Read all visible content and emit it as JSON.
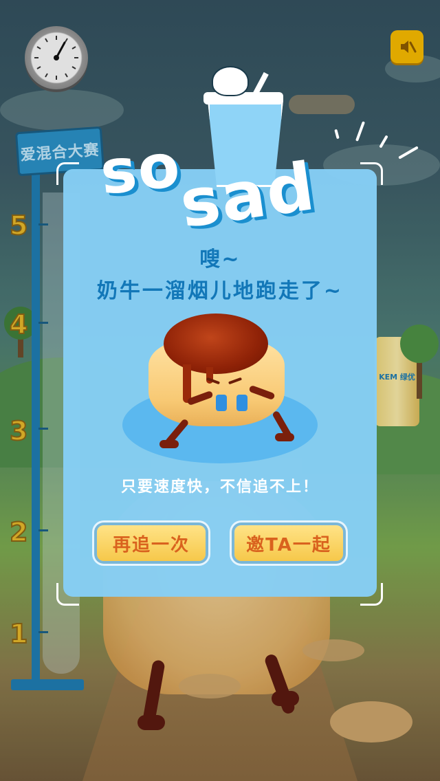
{
  "game": {
    "ruler_sign": "爱混合大赛",
    "ruler_numbers": [
      "5",
      "4",
      "3",
      "2",
      "1"
    ],
    "background_can_label": "KEM 绿优"
  },
  "popup": {
    "title_so": "so",
    "title_sad": "sad",
    "message_line1": "嗖~",
    "message_line2": "奶牛一溜烟儿地跑走了~",
    "slogan": "只要速度快，不信追不上！",
    "retry_button": "再追一次",
    "invite_button": "邀TA一起"
  },
  "colors": {
    "panel": "#86cef5",
    "title_text": "#1277b8",
    "button_bg": "#f6c84a",
    "button_text": "#d9621e",
    "mute_button": "#f3b800"
  },
  "icons": {
    "clock": "clock-icon",
    "mute": "speaker-mute-icon"
  }
}
